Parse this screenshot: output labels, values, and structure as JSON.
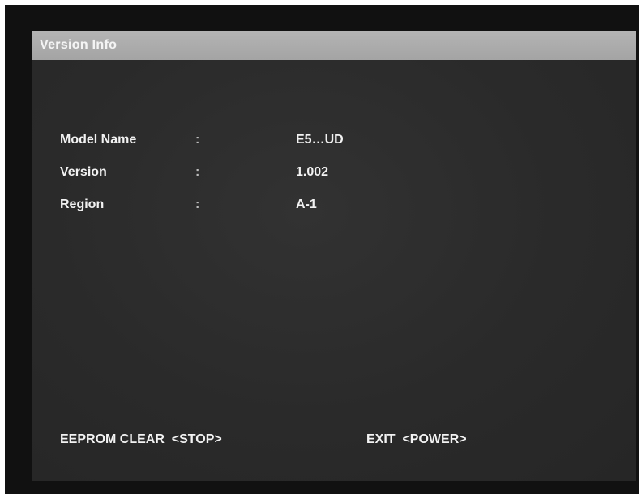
{
  "panel": {
    "title": "Version Info"
  },
  "info": [
    {
      "label": "Model Name",
      "separator": ":",
      "value": "E5…UD"
    },
    {
      "label": "Version",
      "separator": ":",
      "value": "1.002"
    },
    {
      "label": "Region",
      "separator": ":",
      "value": "A-1"
    }
  ],
  "footer": {
    "eeprom_clear": "EEPROM CLEAR  <STOP>",
    "exit": "EXIT  <POWER>"
  },
  "colors": {
    "background": "#111111",
    "panel": "#2b2b2b",
    "title_bar": "#aaaaaa",
    "text": "#f2f2f2"
  }
}
